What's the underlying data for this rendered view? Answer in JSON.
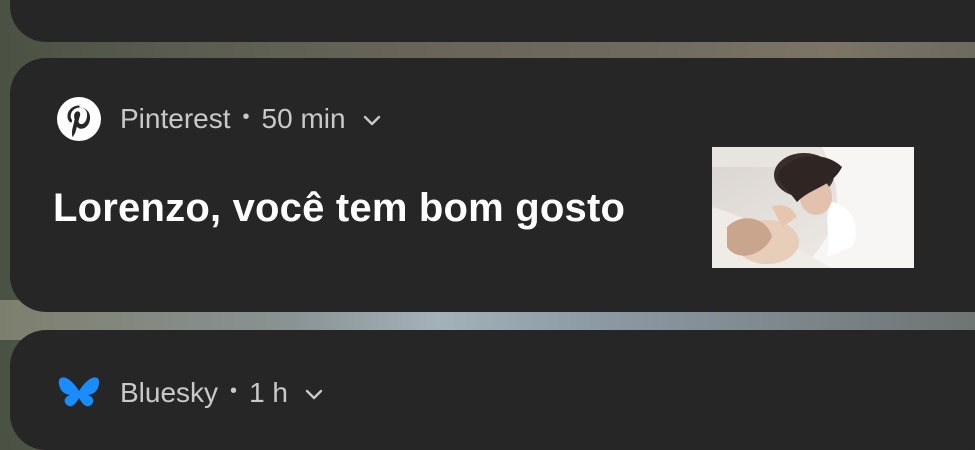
{
  "notifications": [
    {
      "app_name": "Pinterest",
      "separator": "•",
      "time": "50 min",
      "title": "Lorenzo, você tem bom gosto",
      "icon": "pinterest-icon",
      "expand_icon": "chevron-down-icon",
      "thumbnail": "two-women-embracing-photo"
    },
    {
      "app_name": "Bluesky",
      "separator": "•",
      "time": "1 h",
      "icon": "bluesky-butterfly-icon",
      "expand_icon": "chevron-down-icon"
    }
  ],
  "colors": {
    "card_bg": "#262626",
    "pinterest_white": "#ffffff",
    "bluesky_blue": "#1a8cff"
  }
}
